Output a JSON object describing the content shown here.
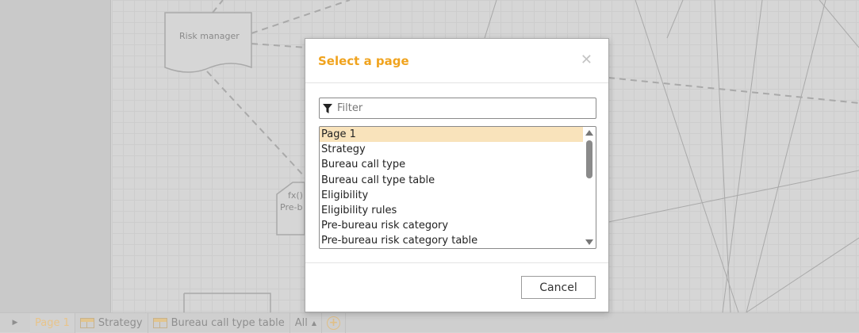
{
  "canvas": {
    "shapes": [
      {
        "label": "Risk manager"
      },
      {
        "label": "fx()"
      },
      {
        "label": "Pre-b"
      }
    ]
  },
  "modal": {
    "title": "Select a page",
    "close_icon": "close-icon",
    "filter": {
      "placeholder": "Filter",
      "value": ""
    },
    "pages": [
      "Page 1",
      "Strategy",
      "Bureau call type",
      "Bureau call type table",
      "Eligibility",
      "Eligibility rules",
      "Pre-bureau risk category",
      "Pre-bureau risk category table"
    ],
    "selected": "Page 1",
    "cancel_label": "Cancel"
  },
  "bottombar": {
    "tabs": [
      {
        "label": "Page 1",
        "active": true
      },
      {
        "label": "Strategy",
        "icon": "table-icon"
      },
      {
        "label": "Bureau call type table",
        "icon": "table-icon"
      }
    ],
    "all_label": "All"
  },
  "colors": {
    "accent": "#f0a31e",
    "selected_bg": "#f9e3bb"
  }
}
